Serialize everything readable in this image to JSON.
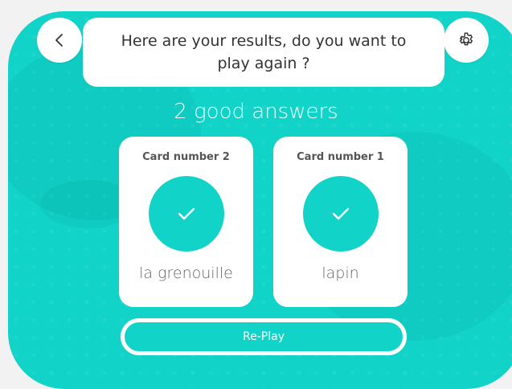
{
  "header": {
    "back_icon": "chevron-left-icon",
    "settings_icon": "gear-icon",
    "question": "Here are your results, do you want to play again ?"
  },
  "results": {
    "score_text": "2 good answers",
    "cards": [
      {
        "title": "Card number 2",
        "word": "la grenouille",
        "status_icon": "check-icon"
      },
      {
        "title": "Card number 1",
        "word": "lapin",
        "status_icon": "check-icon"
      }
    ]
  },
  "actions": {
    "replay_label": "Re-Play"
  },
  "colors": {
    "accent": "#12d3c8",
    "card_bg": "#ffffff",
    "page_bg": "#f2f2f2"
  }
}
